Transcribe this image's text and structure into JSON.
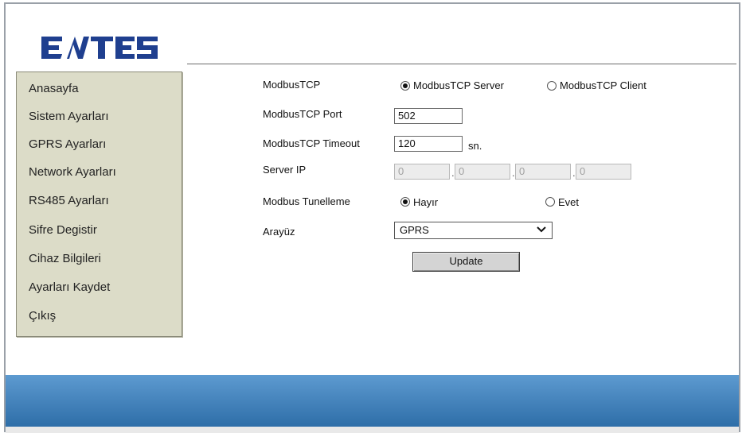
{
  "brand": {
    "name": "ENTES",
    "color": "#1f3f8f"
  },
  "sidebar": {
    "items": [
      {
        "label": "Anasayfa"
      },
      {
        "label": "Sistem Ayarları"
      },
      {
        "label": "GPRS Ayarları"
      },
      {
        "label": "Network Ayarları"
      },
      {
        "label": "RS485 Ayarları"
      },
      {
        "label": "Sifre Degistir"
      },
      {
        "label": "Cihaz Bilgileri"
      },
      {
        "label": "Ayarları Kaydet"
      },
      {
        "label": "Çıkış"
      }
    ]
  },
  "form": {
    "modbustcp": {
      "label": "ModbusTCP",
      "options": [
        "ModbusTCP Server",
        "ModbusTCP Client"
      ],
      "selected": "ModbusTCP Server"
    },
    "port": {
      "label": "ModbusTCP Port",
      "value": "502"
    },
    "timeout": {
      "label": "ModbusTCP Timeout",
      "value": "120",
      "unit": "sn."
    },
    "server_ip": {
      "label": "Server IP",
      "octets": [
        "0",
        "0",
        "0",
        "0"
      ]
    },
    "tunnel": {
      "label": "Modbus Tunelleme",
      "options": [
        "Hayır",
        "Evet"
      ],
      "selected": "Hayır"
    },
    "interface": {
      "label": "Arayüz",
      "value": "GPRS"
    },
    "update_label": "Update"
  },
  "colors": {
    "sidebar_bg": "#dcdcc8",
    "footer_top": "#5d9ad0",
    "footer_bottom": "#2e6ea8"
  }
}
